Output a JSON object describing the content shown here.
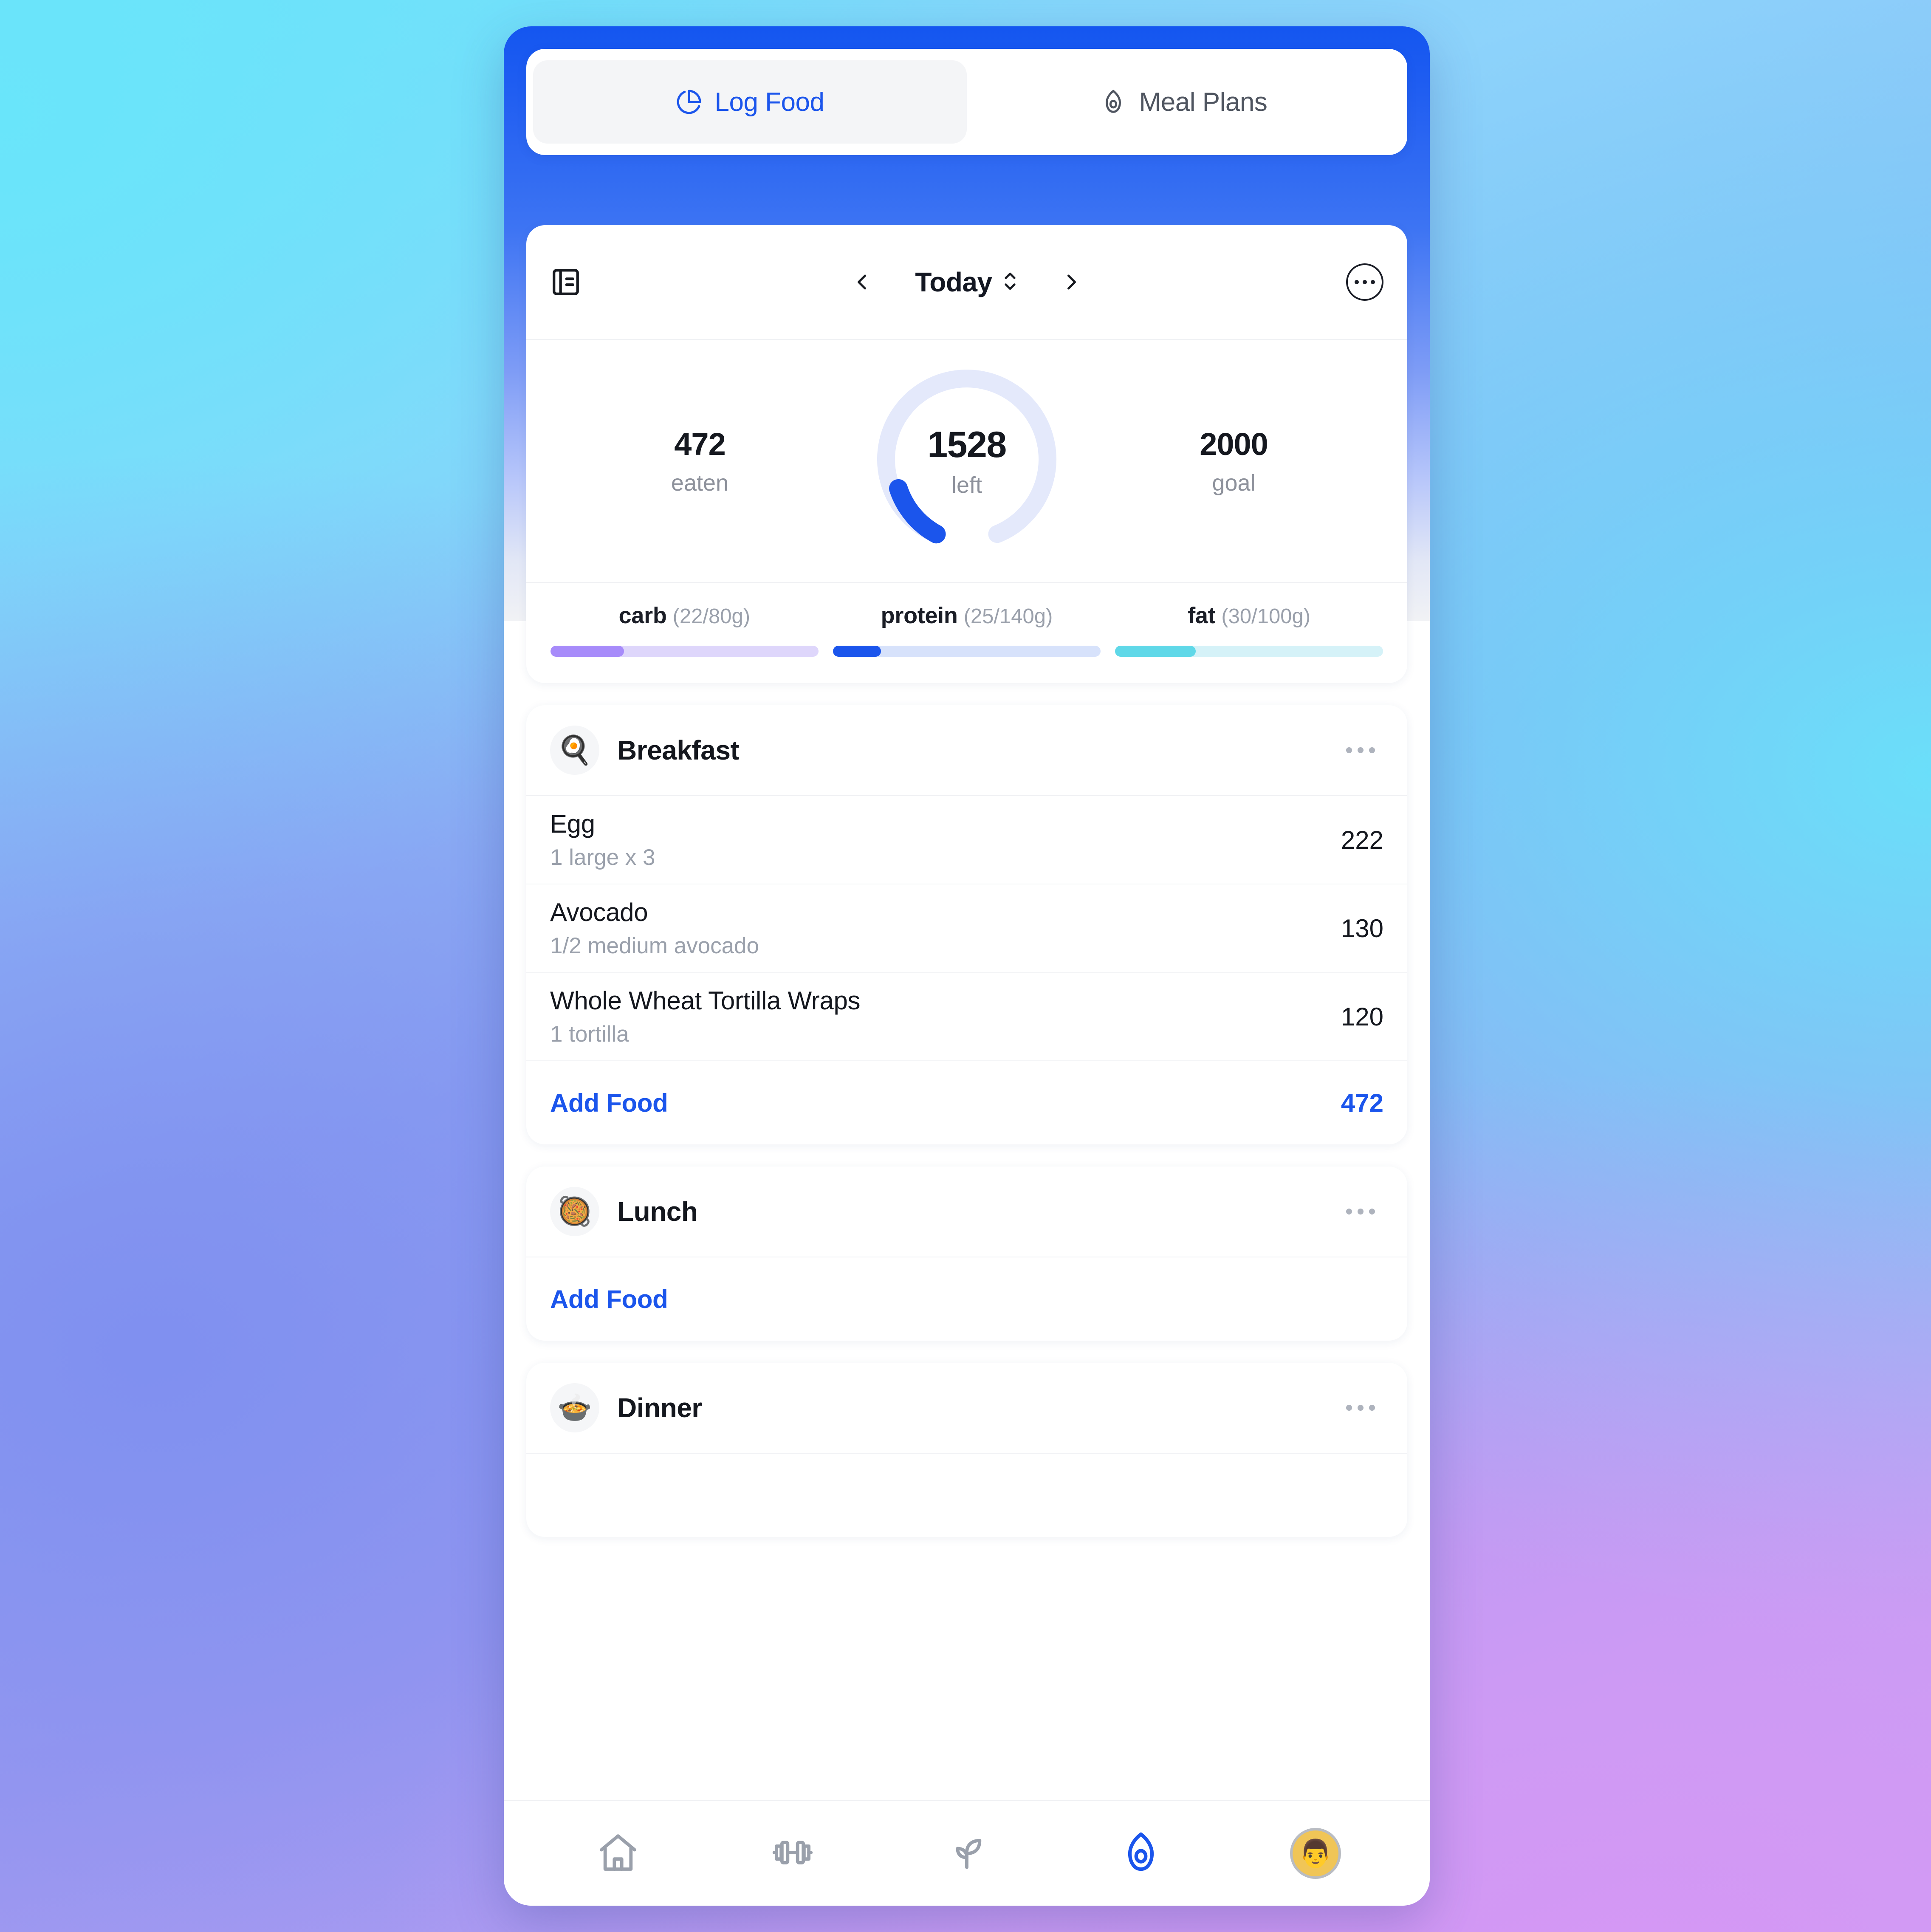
{
  "tabs": [
    {
      "label": "Log Food",
      "icon": "pie-chart-icon",
      "active": true
    },
    {
      "label": "Meal Plans",
      "icon": "avocado-icon",
      "active": false
    }
  ],
  "datebar": {
    "journal_icon": "panel-left-icon",
    "prev_icon": "chevron-left-icon",
    "date_label": "Today",
    "stepper_icon": "chevron-up-down-icon",
    "next_icon": "chevron-right-icon",
    "more_icon": "more-horizontal-icon"
  },
  "summary": {
    "eaten_value": "472",
    "eaten_label": "eaten",
    "left_value": "1528",
    "left_label": "left",
    "goal_value": "2000",
    "goal_label": "goal"
  },
  "macros": [
    {
      "name": "carb",
      "amount": "(22/80g)",
      "consumed": 22,
      "target": 80,
      "percent": 27.5,
      "color": "#a78bfa",
      "track": "#ded6fb"
    },
    {
      "name": "protein",
      "amount": "(25/140g)",
      "consumed": 25,
      "target": 140,
      "percent": 17.9,
      "color": "#1b55ec",
      "track": "#d7e2fb"
    },
    {
      "name": "fat",
      "amount": "(30/100g)",
      "consumed": 30,
      "target": 100,
      "percent": 30.0,
      "color": "#5fd8e8",
      "track": "#d5f2f8"
    }
  ],
  "accent": {
    "brand_blue": "#1b55ec",
    "header_blue": "#1456f0",
    "ring_track": "#e4e9fb"
  },
  "meals": [
    {
      "name": "Breakfast",
      "emoji": "🍳",
      "emoji_name": "fried-egg-icon",
      "foods": [
        {
          "name": "Egg",
          "serving": "1 large x 3",
          "calories": "222"
        },
        {
          "name": "Avocado",
          "serving": "1/2 medium avocado",
          "calories": "130"
        },
        {
          "name": "Whole Wheat Tortilla Wraps",
          "serving": "1 tortilla",
          "calories": "120"
        }
      ],
      "add_label": "Add Food",
      "total": "472"
    },
    {
      "name": "Lunch",
      "emoji": "🥘",
      "emoji_name": "paella-icon",
      "foods": [],
      "add_label": "Add Food",
      "total": ""
    },
    {
      "name": "Dinner",
      "emoji": "🍲",
      "emoji_name": "pot-of-food-icon",
      "foods": [],
      "add_label": "",
      "total": ""
    }
  ],
  "bottom_nav": [
    {
      "icon": "home-icon",
      "active": false
    },
    {
      "icon": "dumbbell-icon",
      "active": false
    },
    {
      "icon": "sprout-icon",
      "active": false
    },
    {
      "icon": "avocado-icon",
      "active": true
    },
    {
      "icon": "avatar-icon",
      "active": false,
      "emoji": "👨"
    }
  ]
}
